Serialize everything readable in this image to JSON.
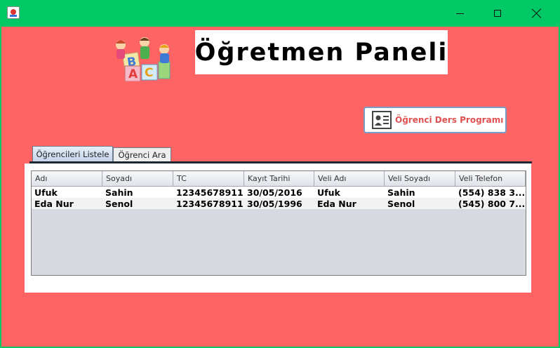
{
  "window": {
    "app_icon": "java-cup-icon",
    "controls": {
      "minimize": "minimize-icon",
      "maximize": "maximize-icon",
      "close": "close-icon"
    },
    "titlebar_color": "#00c864"
  },
  "header": {
    "logo": "abc-blocks-kids-logo",
    "title": "Öğretmen Paneli"
  },
  "ders_programi_button": {
    "label": "Öğrenci Ders Programı",
    "icon": "id-card-icon"
  },
  "tabs": [
    {
      "label": "Öğrencileri Listele",
      "selected": true
    },
    {
      "label": "Öğrenci Ara",
      "selected": false
    }
  ],
  "table": {
    "columns": [
      "Adı",
      "Soyadı",
      "TC",
      "Kayıt Tarihi",
      "Veli Adı",
      "Veli Soyadı",
      "Veli Telefon"
    ],
    "rows": [
      [
        "Ufuk",
        "Sahin",
        "12345678911",
        "30/05/2016",
        "Ufuk",
        "Sahin",
        "(554) 838 3..."
      ],
      [
        "Eda Nur",
        "Senol",
        "12345678911",
        "30/05/1996",
        "Eda Nur",
        "Senol",
        "(545) 800 7..."
      ]
    ]
  },
  "colors": {
    "background": "#ff6464",
    "button_text": "#e05252",
    "table_empty_area": "#d6d9df"
  }
}
